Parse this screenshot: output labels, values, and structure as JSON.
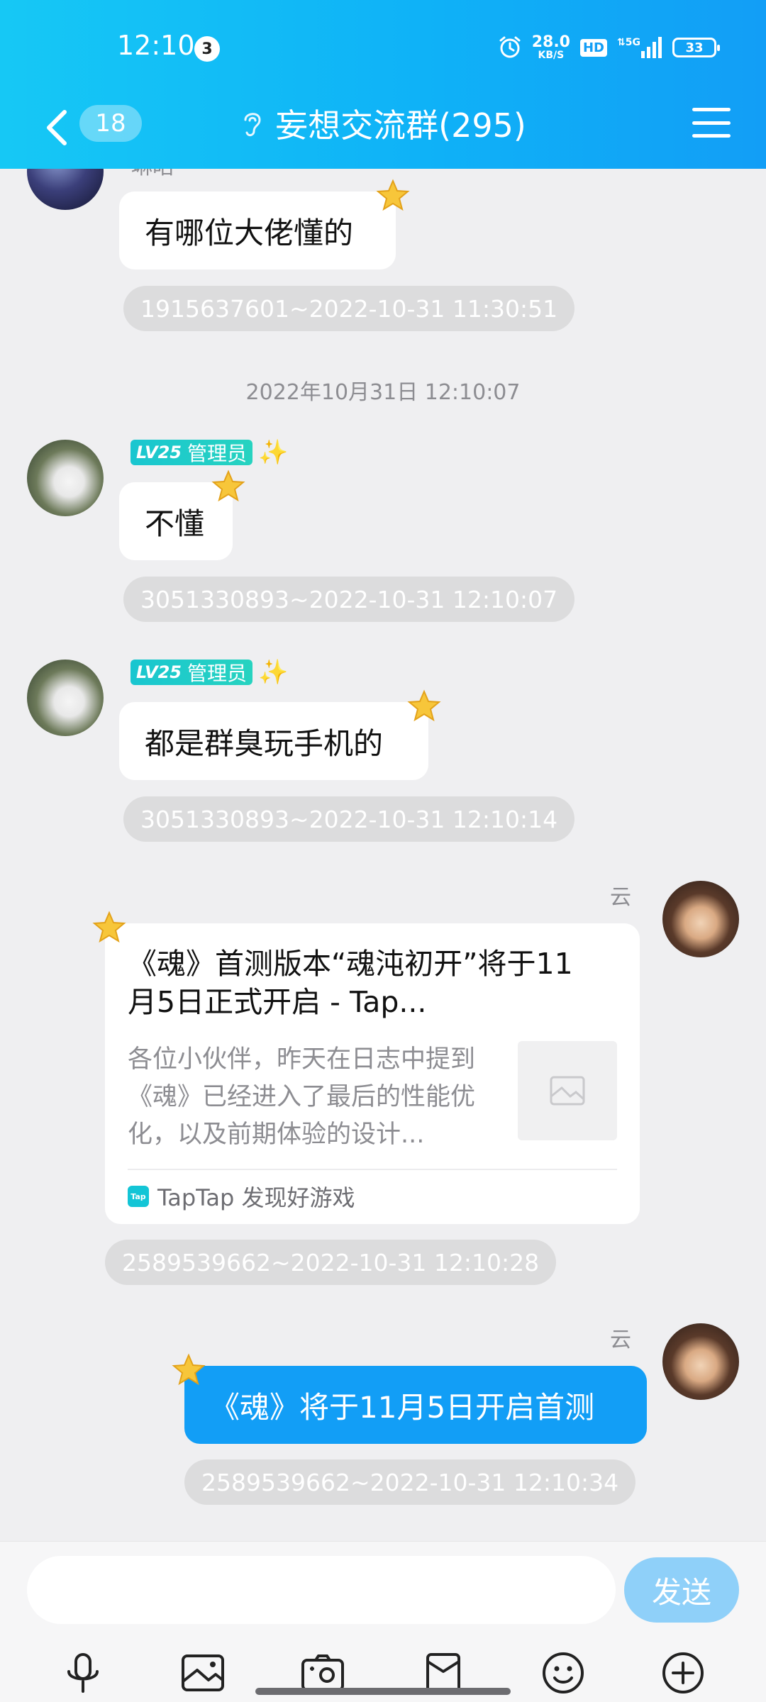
{
  "status_bar": {
    "time": "12:10",
    "notification_count": "3",
    "net_speed": "28.0",
    "net_speed_unit": "KB/S",
    "hd_label": "HD",
    "network_label": "5G",
    "battery": "33"
  },
  "nav": {
    "unread_count": "18",
    "group_title": "妄想交流群(295)"
  },
  "messages": [
    {
      "sender": "琳昭",
      "text": "有哪位大佬懂的",
      "id_time": "1915637601~2022-10-31 11:30:51"
    },
    {
      "system_time": "2022年10月31日 12:10:07"
    },
    {
      "badge_level": "LV25",
      "badge_role": "管理员",
      "text": "不懂",
      "id_time": "3051330893~2022-10-31 12:10:07"
    },
    {
      "badge_level": "LV25",
      "badge_role": "管理员",
      "text": "都是群臭玩手机的",
      "id_time": "3051330893~2022-10-31 12:10:14"
    },
    {
      "sender": "云",
      "card": {
        "title": "《魂》首测版本“魂沌初开”将于11月5日正式开启 - Tap...",
        "description": "各位小伙伴，昨天在日志中提到《魂》已经进入了最后的性能优化，以及前期体验的设计...",
        "source": "TapTap 发现好游戏",
        "source_logo": "Tap"
      },
      "id_time": "2589539662~2022-10-31 12:10:28"
    },
    {
      "sender": "云",
      "text": "《魂》将于11月5日开启首测",
      "id_time": "2589539662~2022-10-31 12:10:34"
    }
  ],
  "input": {
    "value": "",
    "placeholder": "",
    "send_label": "发送"
  },
  "toolbar": [
    "microphone-icon",
    "image-icon",
    "camera-icon",
    "red-packet-icon",
    "emoji-icon",
    "plus-icon"
  ],
  "colors": {
    "header_start": "#16c8f5",
    "header_end": "#129ef6",
    "self_bubble": "#129ef6",
    "send_button": "#8fd0f9"
  }
}
